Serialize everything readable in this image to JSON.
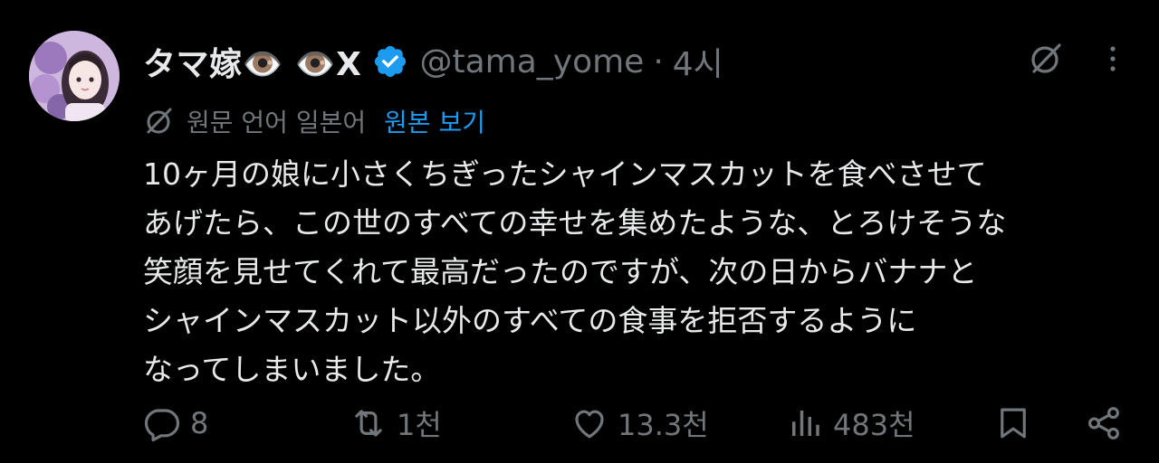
{
  "tweet": {
    "display_name": "タマ嫁👁️ 👁️X",
    "handle": "@tama_yome",
    "separator": "·",
    "time": "4시",
    "translation_note": "원문 언어 일본어",
    "show_original": "원본 보기",
    "text_lines": [
      "10ヶ月の娘に小さくちぎったシャインマスカットを食べさせて",
      "あげたら、この世のすべての幸せを集めたような、とろけそうな",
      "笑顔を見せてくれて最高だったのですが、次の日からバナナと",
      "シャインマスカット以外のすべての食事を拒否するように",
      "なってしまいました。"
    ]
  },
  "actions": {
    "reply_count": "8",
    "retweet_count": "1천",
    "like_count": "13.3천",
    "views_count": "483천"
  },
  "icons": {
    "reply": "reply-icon",
    "retweet": "retweet-icon",
    "like": "like-icon",
    "views": "views-icon",
    "bookmark": "bookmark-icon",
    "share": "share-icon",
    "grok": "grok-icon",
    "more": "more-icon",
    "verified": "verified-badge-icon"
  },
  "colors": {
    "background": "#000000",
    "text": "#e7e9ea",
    "muted": "#71767b",
    "accent": "#1d9bf0"
  }
}
